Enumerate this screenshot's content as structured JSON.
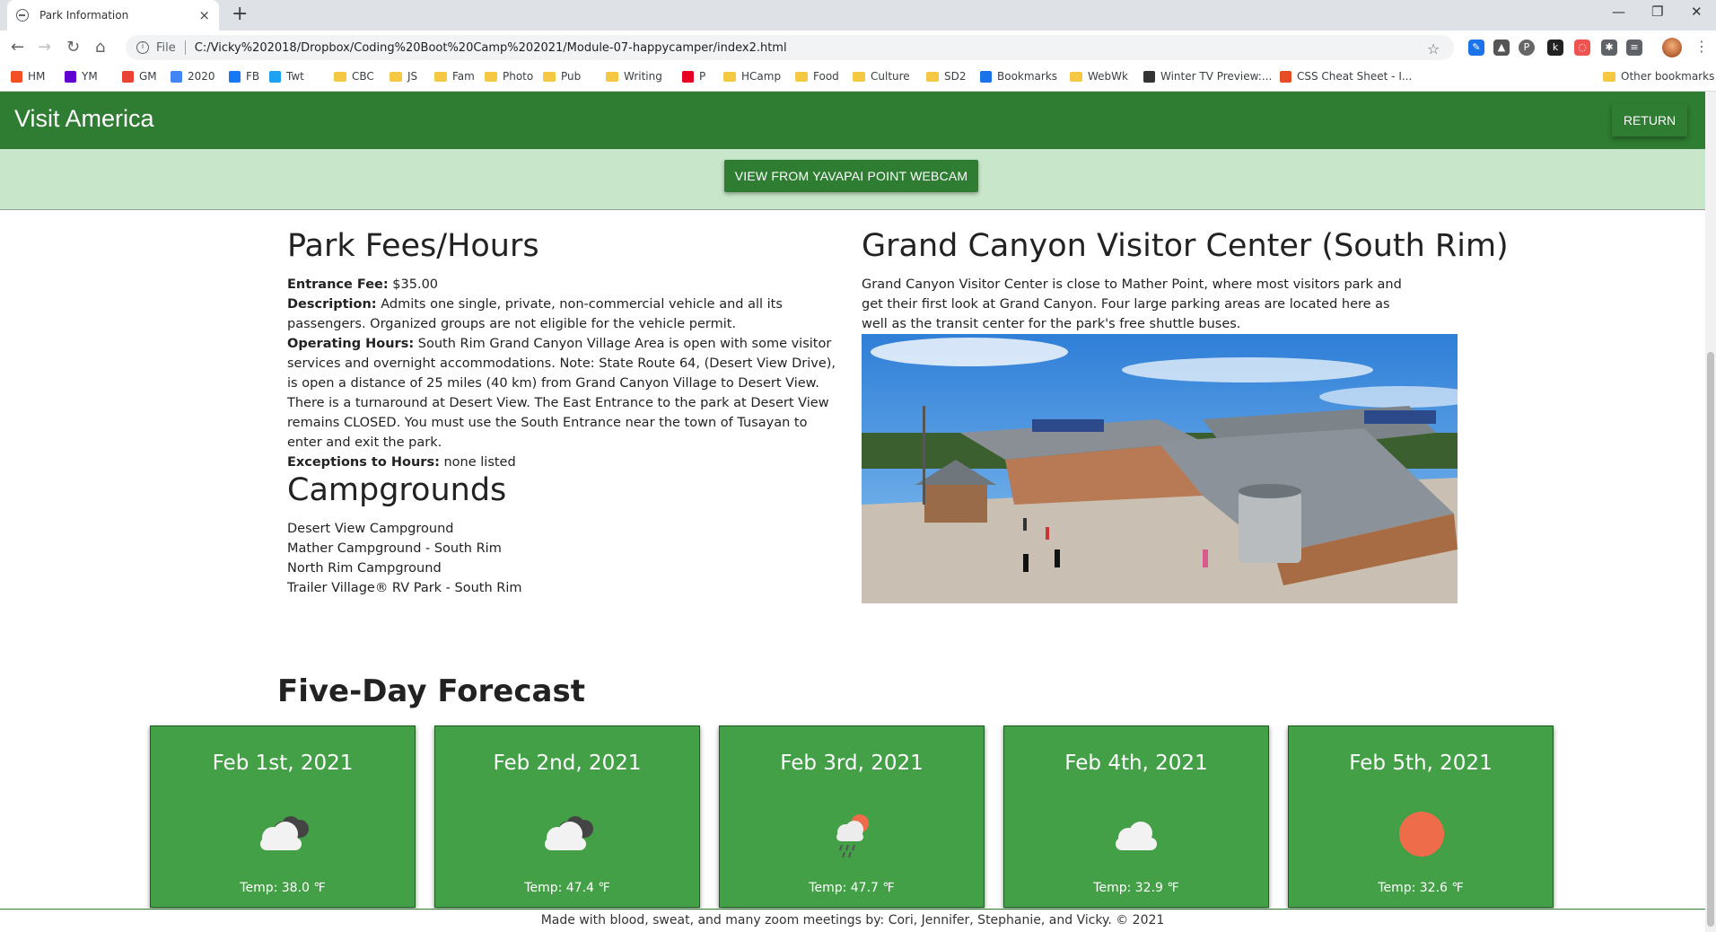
{
  "browser": {
    "tab_title": "Park Information",
    "new_tab": "+",
    "close_tab": "×",
    "url_prefix": "File",
    "url": "C:/Vicky%202018/Dropbox/Coding%20Boot%20Camp%202021/Module-07-happycamper/index2.html",
    "bookmarks": [
      {
        "label": "HM",
        "color": "#f25022"
      },
      {
        "label": "YM",
        "color": "#6001d2"
      },
      {
        "label": "GM",
        "color": "#ea4335"
      },
      {
        "label": "2020",
        "color": "#4285f4"
      },
      {
        "label": "FB",
        "color": "#1877f2"
      },
      {
        "label": "Twt",
        "color": "#1da1f2"
      },
      {
        "label": "CBC",
        "folder": true
      },
      {
        "label": "JS",
        "folder": true
      },
      {
        "label": "Fam",
        "folder": true
      },
      {
        "label": "Photo",
        "folder": true
      },
      {
        "label": "Pub",
        "folder": true
      },
      {
        "label": "Writing",
        "folder": true
      },
      {
        "label": "P",
        "color": "#e60023"
      },
      {
        "label": "HCamp",
        "folder": true
      },
      {
        "label": "Food",
        "folder": true
      },
      {
        "label": "Culture",
        "folder": true
      },
      {
        "label": "SD2",
        "folder": true
      },
      {
        "label": "Bookmarks",
        "color": "#1a73e8"
      },
      {
        "label": "WebWk",
        "folder": true
      },
      {
        "label": "Winter TV Preview:...",
        "color": "#333333"
      },
      {
        "label": "CSS Cheat Sheet - I...",
        "color": "#e44d26"
      }
    ],
    "other_bookmarks": "Other bookmarks"
  },
  "header": {
    "brand": "Visit America",
    "return_label": "RETURN"
  },
  "webcam": {
    "label": "VIEW FROM YAVAPAI POINT WEBCAM"
  },
  "fees": {
    "title": "Park Fees/Hours",
    "entrance_label": "Entrance Fee:",
    "entrance_value": " $35.00",
    "description_label": "Description:",
    "description_value": " Admits one single, private, non-commercial vehicle and all its passengers. Organized groups are not eligible for the vehicle permit.",
    "hours_label": "Operating Hours:",
    "hours_value": " South Rim Grand Canyon Village Area is open with some visitor services and overnight accommodations. Note: State Route 64, (Desert View Drive), is open a distance of 25 miles (40 km) from Grand Canyon Village to Desert View. There is a turnaround at Desert View. The East Entrance to the park at Desert View remains CLOSED. You must use the South Entrance near the town of Tusayan to enter and exit the park.",
    "exceptions_label": "Exceptions to Hours:",
    "exceptions_value": " none listed"
  },
  "campgrounds": {
    "title": "Campgrounds",
    "items": [
      "Desert View Campground",
      "Mather Campground - South Rim",
      "North Rim Campground",
      "Trailer Village® RV Park - South Rim"
    ]
  },
  "visitor_center": {
    "title": "Grand Canyon Visitor Center (South Rim)",
    "description": "Grand Canyon Visitor Center is close to Mather Point, where most visitors park and get their first look at Grand Canyon. Four large parking areas are located here as well as the transit center for the park's free shuttle buses."
  },
  "forecast": {
    "title": "Five-Day Forecast",
    "days": [
      {
        "date": "Feb 1st, 2021",
        "icon": "cloudy-icon",
        "temp": "Temp: 38.0 ℉"
      },
      {
        "date": "Feb 2nd, 2021",
        "icon": "cloudy-icon",
        "temp": "Temp: 47.4 ℉"
      },
      {
        "date": "Feb 3rd, 2021",
        "icon": "rain-sun-icon",
        "temp": "Temp: 47.7 ℉"
      },
      {
        "date": "Feb 4th, 2021",
        "icon": "cloud-icon",
        "temp": "Temp: 32.9 ℉"
      },
      {
        "date": "Feb 5th, 2021",
        "icon": "sun-icon",
        "temp": "Temp: 32.6 ℉"
      }
    ]
  },
  "footer": {
    "text": "Made with blood, sweat, and many zoom meetings by: Cori, Jennifer, Stephanie, and Vicky. © 2021"
  },
  "colors": {
    "header_green": "#2e7d32",
    "band_green": "#c8e6c9",
    "card_green": "#43a047",
    "sun_orange": "#ef6c4a"
  }
}
